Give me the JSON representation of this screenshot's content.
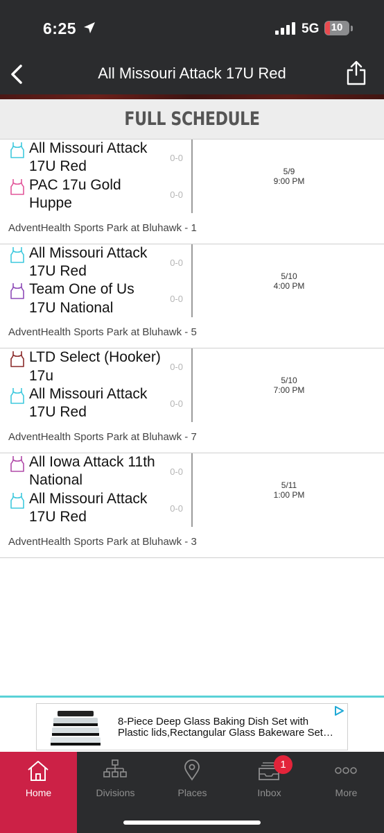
{
  "status_bar": {
    "time": "6:25",
    "network": "5G",
    "battery": "10"
  },
  "nav": {
    "title": "All Missouri Attack 17U Red"
  },
  "section": {
    "title": "FULL SCHEDULE"
  },
  "games": [
    {
      "teams": [
        {
          "name": "All Missouri Attack 17U Red",
          "score": "0-0",
          "jersey_color": "#3fc9de"
        },
        {
          "name": "PAC 17u Gold Huppe",
          "score": "0-0",
          "jersey_color": "#e2579a"
        }
      ],
      "date": "5/9",
      "time": "9:00 PM",
      "venue": "AdventHealth Sports Park at Bluhawk - 1"
    },
    {
      "teams": [
        {
          "name": "All Missouri Attack 17U Red",
          "score": "0-0",
          "jersey_color": "#3fc9de"
        },
        {
          "name": "Team One of Us 17U National",
          "score": "0-0",
          "jersey_color": "#8e4bb8"
        }
      ],
      "date": "5/10",
      "time": "4:00 PM",
      "venue": "AdventHealth Sports Park at Bluhawk - 5"
    },
    {
      "teams": [
        {
          "name": "LTD Select (Hooker) 17u",
          "score": "0-0",
          "jersey_color": "#8a2a2a"
        },
        {
          "name": "All Missouri Attack 17U Red",
          "score": "0-0",
          "jersey_color": "#3fc9de"
        }
      ],
      "date": "5/10",
      "time": "7:00 PM",
      "venue": "AdventHealth Sports Park at Bluhawk - 7"
    },
    {
      "teams": [
        {
          "name": "All Iowa Attack 11th National",
          "score": "0-0",
          "jersey_color": "#b04aa8"
        },
        {
          "name": "All Missouri Attack 17U Red",
          "score": "0-0",
          "jersey_color": "#3fc9de"
        }
      ],
      "date": "5/11",
      "time": "1:00 PM",
      "venue": "AdventHealth Sports Park at Bluhawk - 3"
    }
  ],
  "ad": {
    "text_line1": "8-Piece Deep Glass Baking Dish Set with",
    "text_line2": "Plastic lids,Rectangular Glass Bakeware Set…"
  },
  "tabs": [
    {
      "label": "Home",
      "icon": "home-icon",
      "active": true
    },
    {
      "label": "Divisions",
      "icon": "bracket-icon"
    },
    {
      "label": "Places",
      "icon": "map-pin-icon"
    },
    {
      "label": "Inbox",
      "icon": "inbox-icon",
      "badge": "1"
    },
    {
      "label": "More",
      "icon": "more-dots-icon"
    }
  ],
  "colors": {
    "accent": "#cc2146",
    "bar": "#2b2c2e",
    "ad_separator": "#5ad1d7"
  }
}
